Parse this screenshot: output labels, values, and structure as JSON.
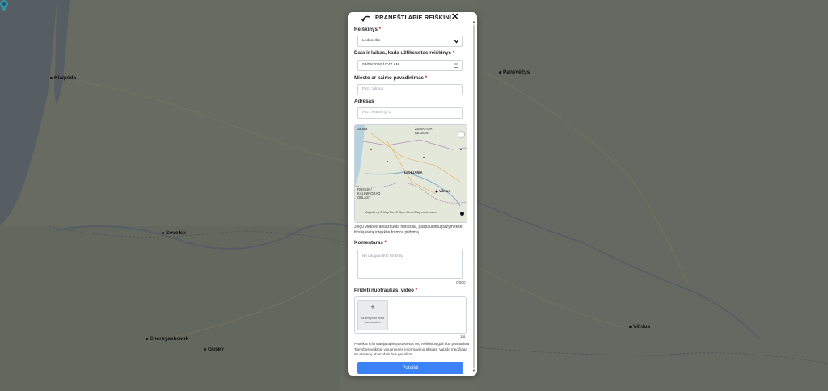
{
  "background_map": {
    "cities": [
      {
        "name": "Klaipėda"
      },
      {
        "name": "Panevėžys"
      },
      {
        "name": "Sovetsk"
      },
      {
        "name": "Chernyakhovsk"
      },
      {
        "name": "Gusev"
      },
      {
        "name": "Vilnius"
      }
    ]
  },
  "modal": {
    "title": "PRANEŠTI APIE REIŠKINĮ",
    "fields": {
      "phenomenon": {
        "label": "Reiškinys",
        "required_mark": "*",
        "value": "Ledonešis"
      },
      "datetime": {
        "label": "Data ir laikas, kada užfiksuotas reiškinys",
        "required_mark": "*",
        "value": "03/05/2026 10:47 AM"
      },
      "city": {
        "label": "Miesto ar kaimo pavadinimas",
        "required_mark": "*",
        "placeholder": "Pvz.: Vilnius"
      },
      "address": {
        "label": "Adresas",
        "placeholder": "Pvz.: Kauno g. 1"
      },
      "comment": {
        "label": "Komentaras",
        "required_mark": "*",
        "placeholder": "Ne daugiau 500 simbolių",
        "counter": "0/500"
      },
      "media": {
        "label": "Pridėti nuotraukas, video",
        "required_mark": "*",
        "upload_plus": "+",
        "upload_text": "Nutempkite arba paspauskite",
        "counter": "1/6"
      }
    },
    "mini_map": {
      "labels": {
        "japan": "Japaja",
        "samogitia": "ŽEMAITIJA REGION",
        "lithuania": "LITHUANIA",
        "vilnius": "Vilnius",
        "kaliningrad": "RUSSIA / KALININGRAD OBLAST",
        "attribution": "MapLibre | © MapTiler © OpenStreetMap contributors"
      }
    },
    "location_note": "Jeigu vietovė atvaizduota netiksliai, paspaudimu pažymėkite tikslią vietą ir tęskite formos pildymą",
    "privacy_note": "Pateikta informacija apie pastebėtus orų reiškinius gali būti panaudota Tarnybos veikloje visuomenės informavimo tikslais. Vaizdo medžiaga su asmenų atvaizdais bus pašalinta.",
    "submit_label": "Pateikti",
    "colors": {
      "accent": "#3b82f6",
      "required": "#c62828"
    }
  }
}
